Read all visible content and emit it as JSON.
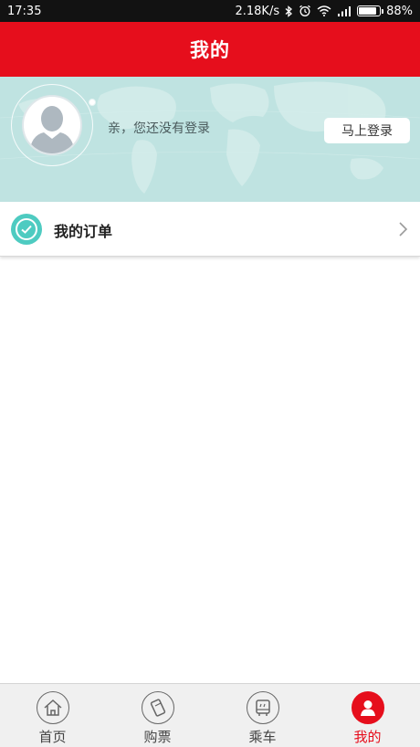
{
  "status_bar": {
    "time": "17:35",
    "network_speed": "2.18K/s",
    "battery_percent": "88%",
    "battery_level": 0.88,
    "icons": [
      "bluetooth-icon",
      "alarm-icon",
      "wifi-icon",
      "signal-icon",
      "battery-icon"
    ]
  },
  "header": {
    "title": "我的"
  },
  "profile": {
    "prompt": "亲，您还没有登录",
    "login_button": "马上登录"
  },
  "menu": {
    "orders_label": "我的订单"
  },
  "tabs": [
    {
      "label": "首页",
      "icon": "home-icon",
      "active": false
    },
    {
      "label": "购票",
      "icon": "ticket-icon",
      "active": false
    },
    {
      "label": "乘车",
      "icon": "bus-icon",
      "active": false
    },
    {
      "label": "我的",
      "icon": "user-icon",
      "active": true
    }
  ],
  "colors": {
    "brand_red": "#e60e1c",
    "banner_teal": "#bfe3e1",
    "orders_icon": "#4ecbc1"
  }
}
